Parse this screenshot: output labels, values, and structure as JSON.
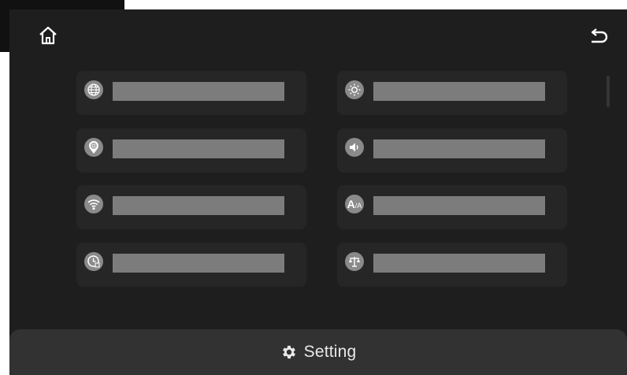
{
  "footer": {
    "title": "Setting",
    "icon": "gear-icon"
  },
  "header": {
    "home_icon": "home-icon",
    "back_icon": "return-icon"
  },
  "colors": {
    "screen_bg": "#1e1e1e",
    "tile_bg": "#262626",
    "icon_bg": "#8a8a8a",
    "label_bar": "#7c7c7c",
    "footer_bg": "#323232"
  },
  "settings_items": [
    {
      "icon": "globe-icon"
    },
    {
      "icon": "brightness-icon"
    },
    {
      "icon": "location-icon"
    },
    {
      "icon": "volume-icon"
    },
    {
      "icon": "wifi-icon"
    },
    {
      "icon": "font-size-icon",
      "glyph": "A",
      "glyph_small": "/A"
    },
    {
      "icon": "clock-icon"
    },
    {
      "icon": "scale-icon"
    }
  ]
}
